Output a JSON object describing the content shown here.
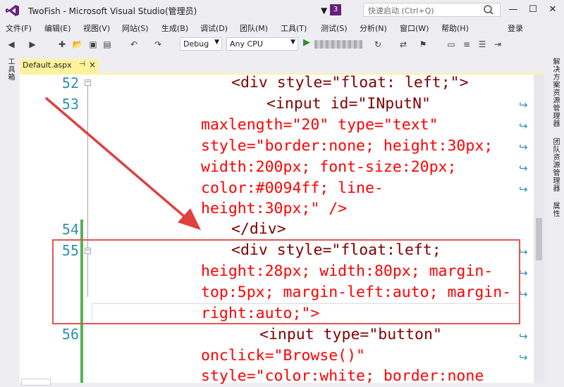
{
  "window": {
    "title": "TwoFish - Microsoft Visual Studio(管理员)",
    "notification_count": "3",
    "quick_launch_placeholder": "快速启动 (Ctrl+Q)",
    "minimize": "—",
    "maximize": "☐",
    "close": "✕"
  },
  "menu": {
    "items": [
      "文件(F)",
      "编辑(E)",
      "视图(V)",
      "网站(S)",
      "生成(B)",
      "调试(D)",
      "团队(M)",
      "工具(T)",
      "测试(S)",
      "分析(N)",
      "窗口(W)",
      "帮助(H)"
    ],
    "login": "登录"
  },
  "toolbar": {
    "config": "Debug",
    "platform": "Any CPU"
  },
  "side_panels": {
    "left": "工具箱",
    "right": [
      "解决方案资源管理器",
      "团队资源管理器",
      "属性"
    ]
  },
  "editor": {
    "tab_label": "Default.aspx",
    "tab_pin": "ㅁ",
    "tab_close": "×",
    "line_numbers": [
      "52",
      "53",
      "54",
      "55",
      "56"
    ],
    "code": {
      "l52": "<div style=\"float: left;\">",
      "l53": "<input id=\"INputN\"",
      "l53b": "maxlength=\"20\" type=\"text\"",
      "l53c": "style=\"border:none; height:30px;",
      "l53d": "width:200px; font-size:20px;",
      "l53e": "color:#0094ff; line-",
      "l53f": "height:30px;\" />",
      "l54": "</div>",
      "l55": "<div style=\"float:left;",
      "l55b": "height:28px; width:80px; margin-",
      "l55c": "top:5px; margin-left:auto; margin-",
      "l55d": "right:auto;\">",
      "l56": "<input type=\"button\"",
      "l56b": "onclick=\"Browse()\"",
      "l56c": "style=\"color:white; border:none"
    }
  },
  "colors": {
    "tag": "#800000",
    "attribute": "#ff0000",
    "value": "#0000ff",
    "line_number": "#2b91af",
    "highlight": "#e05555",
    "arrow": "#e04040",
    "tab_active": "#fff29d"
  }
}
